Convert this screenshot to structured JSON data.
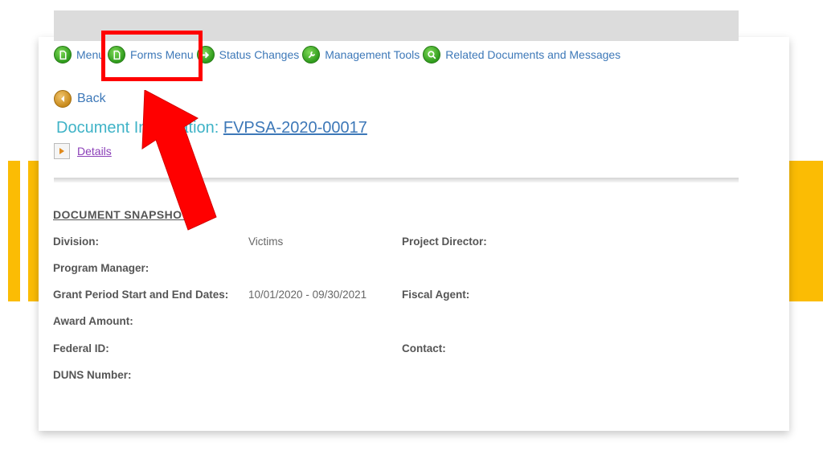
{
  "nav": {
    "items": [
      {
        "label": "Menu",
        "icon": "page-icon"
      },
      {
        "label": "Forms Menu",
        "icon": "page-icon"
      },
      {
        "label": "Status Changes",
        "icon": "arrow-right-icon"
      },
      {
        "label": "Management Tools",
        "icon": "wrench-icon"
      },
      {
        "label": "Related Documents and Messages",
        "icon": "search-icon"
      }
    ]
  },
  "back": {
    "label": "Back"
  },
  "document": {
    "title_prefix": "Document Information: ",
    "id": "FVPSA-2020-00017",
    "details_label": "Details"
  },
  "snapshot": {
    "title": "DOCUMENT SNAPSHOT",
    "fields": {
      "division": {
        "label": "Division:",
        "value": "Victims"
      },
      "program_manager": {
        "label": "Program Manager:",
        "value": ""
      },
      "grant_period": {
        "label": "Grant Period Start and End Dates:",
        "value": "10/01/2020 - 09/30/2021"
      },
      "award_amount": {
        "label": "Award Amount:",
        "value": ""
      },
      "federal_id": {
        "label": "Federal ID:",
        "value": ""
      },
      "duns": {
        "label": "DUNS Number:",
        "value": ""
      },
      "project_director": {
        "label": "Project Director:",
        "value": ""
      },
      "fiscal_agent": {
        "label": "Fiscal Agent:",
        "value": ""
      },
      "contact": {
        "label": "Contact:",
        "value": ""
      }
    }
  },
  "colors": {
    "accent_yellow": "#fbbc04",
    "highlight_red": "#ff0000",
    "link_blue": "#3d78b8",
    "teal_title": "#3fb3c7"
  }
}
